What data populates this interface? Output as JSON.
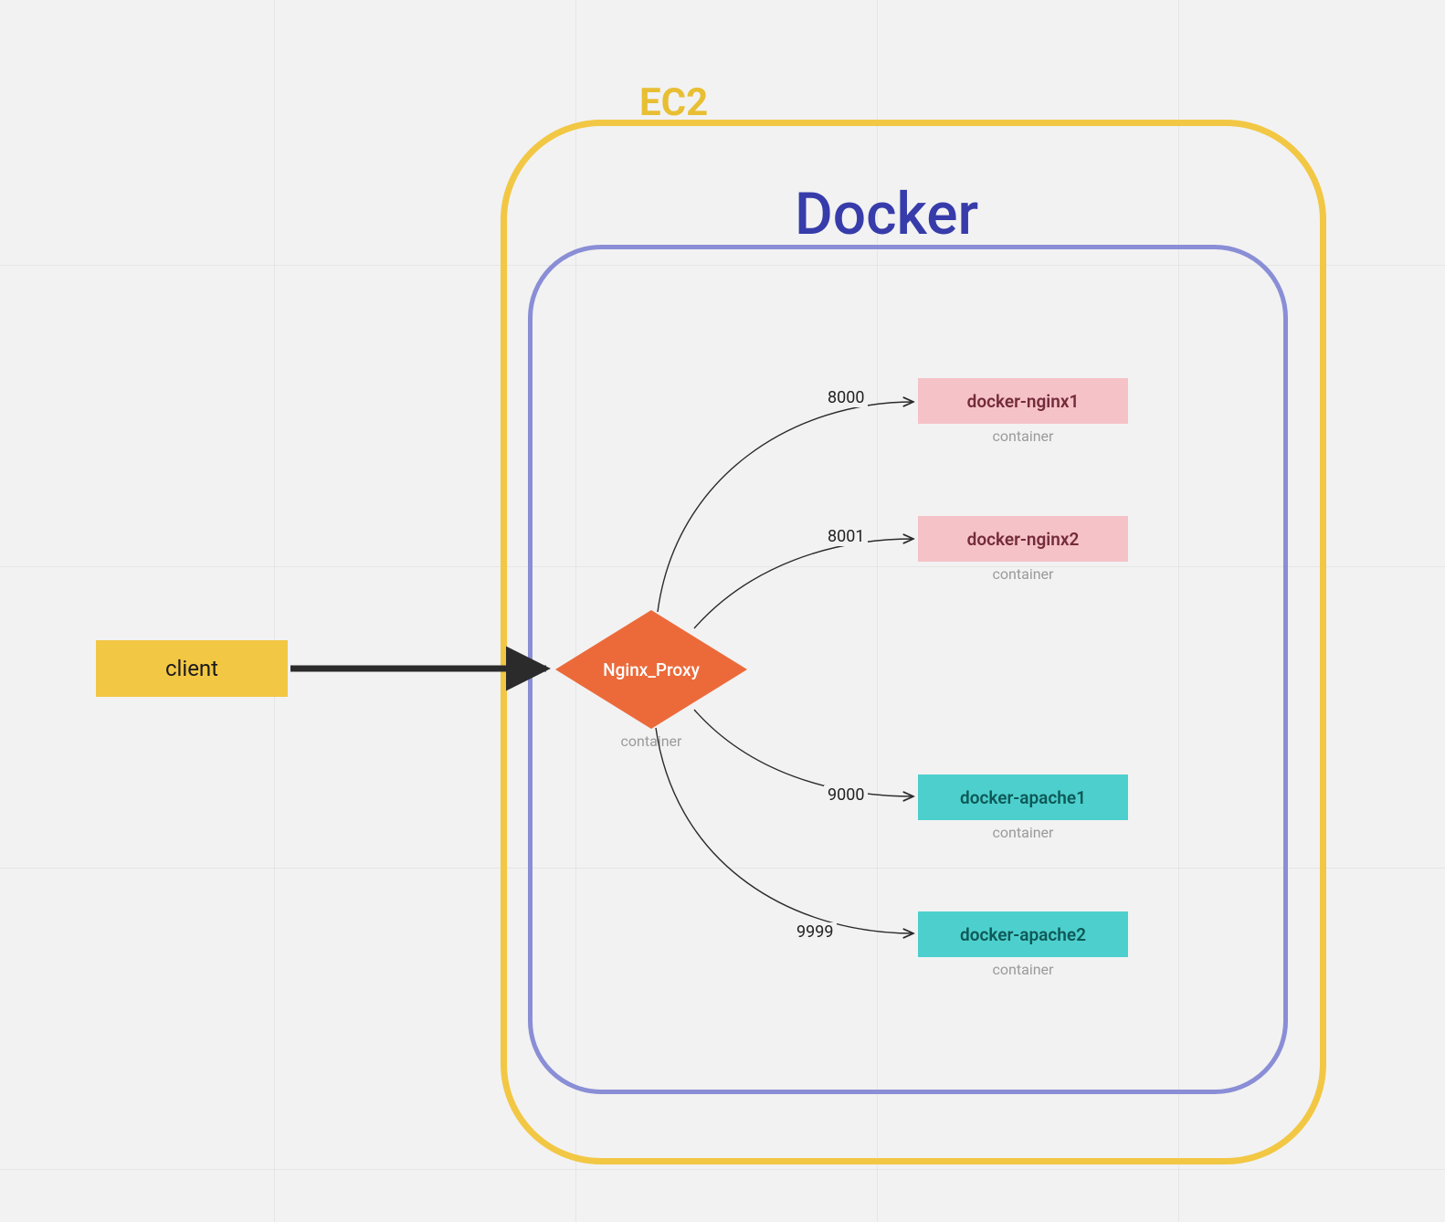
{
  "groups": {
    "ec2": {
      "label": "EC2"
    },
    "docker": {
      "label": "Docker"
    }
  },
  "nodes": {
    "client": {
      "label": "client"
    },
    "proxy": {
      "label": "Nginx_Proxy",
      "sub": "container"
    }
  },
  "containers": [
    {
      "name": "docker-nginx1",
      "sub": "container",
      "color": "pink"
    },
    {
      "name": "docker-nginx2",
      "sub": "container",
      "color": "pink"
    },
    {
      "name": "docker-apache1",
      "sub": "container",
      "color": "teal"
    },
    {
      "name": "docker-apache2",
      "sub": "container",
      "color": "teal"
    }
  ],
  "edges": {
    "ports": [
      "8000",
      "8001",
      "9000",
      "9999"
    ]
  }
}
